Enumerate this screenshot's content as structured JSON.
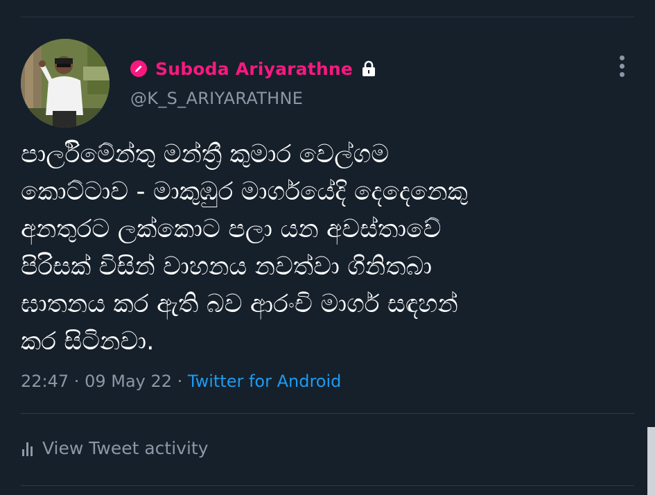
{
  "author": {
    "display_name": "Suboda Ariyarathne",
    "handle": "@K_S_ARIYARATHNE",
    "badge_color": "#f91880",
    "badge_icon": "pencil-icon",
    "protected_icon": "lock-icon",
    "avatar_icon": "profile-photo"
  },
  "tweet": {
    "text": "පාර්ලිමේන්තු මන්ත්‍රී කුමාර වෙල්ගම\nකොට්ටාව - මාකුඹුර මාර්ගයේදි දෙදෙනෙකු\nඅනතුරට ලක්කොට පලා යන අවස්තාවේ\nපිරිසක් විසින් වාහනය නවත්වා ගිනිතබා\nඝාතනය කර ඇති බව ආරංචි මාර්ග සඳහන්\nකර සිටිනවා."
  },
  "meta": {
    "time": "22:47",
    "separator": " · ",
    "date": "09 May 22",
    "source": "Twitter for Android"
  },
  "actions": {
    "activity_label": "View Tweet activity",
    "activity_icon": "bar-chart-icon",
    "more_icon": "more-vertical-icon"
  },
  "colors": {
    "background": "#16202b",
    "link": "#1d9bf0",
    "muted": "#8b98a5"
  }
}
